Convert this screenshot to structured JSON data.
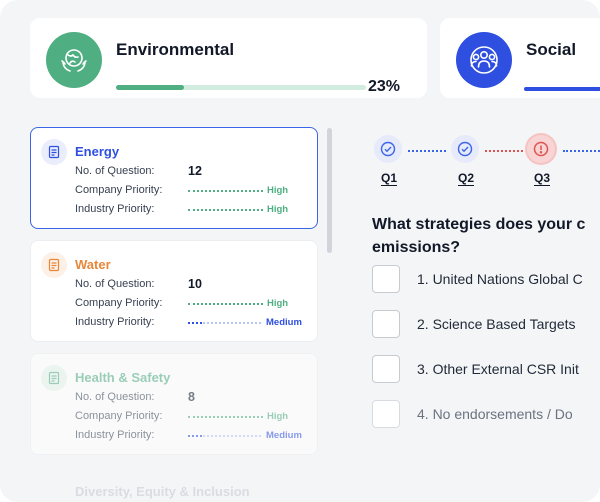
{
  "categories": {
    "environmental": {
      "title": "Environmental",
      "percent_label": "23%",
      "progress": 0.27,
      "icon": "globe-leaf-icon",
      "color": "#4fae82"
    },
    "social": {
      "title": "Social",
      "icon": "people-group-icon",
      "color": "#2e4fe0"
    }
  },
  "topics": {
    "labels": {
      "questions": "No. of Question:",
      "company": "Company Priority:",
      "industry": "Industry Priority:"
    },
    "items": [
      {
        "title": "Energy",
        "count": "12",
        "company_priority": "High",
        "industry_priority": "High",
        "title_color": "#2e4fe0",
        "icon": "energy-document-icon"
      },
      {
        "title": "Water",
        "count": "10",
        "company_priority": "High",
        "industry_priority": "Medium",
        "title_color": "#e8873a",
        "icon": "water-document-icon"
      },
      {
        "title": "Health & Safety",
        "count": "8",
        "company_priority": "High",
        "industry_priority": "Medium",
        "title_color": "#4fae82",
        "icon": "health-safety-document-icon"
      }
    ],
    "next_hidden": "Diversity, Equity & Inclusion"
  },
  "steps": [
    {
      "label": "Q1",
      "state": "done"
    },
    {
      "label": "Q2",
      "state": "done"
    },
    {
      "label": "Q3",
      "state": "error"
    }
  ],
  "question": {
    "line1": "What strategies does your c",
    "line2": "emissions?",
    "options": [
      "1. United Nations Global C",
      "2. Science Based Targets",
      "3. Other External CSR Init",
      "4. No endorsements / Do"
    ]
  },
  "colors": {
    "high": "#4fae82",
    "medium": "#2e4fe0",
    "active_border": "#3b65e8",
    "error": "#e05252"
  }
}
